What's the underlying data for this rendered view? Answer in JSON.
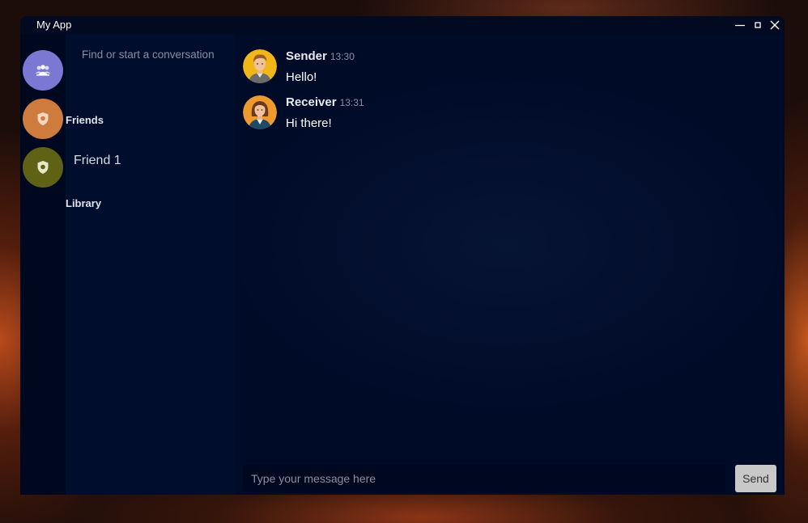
{
  "window": {
    "title": "My App"
  },
  "servers": [
    {
      "name": "group-server",
      "icon": "people-icon",
      "color": "#7b78d4"
    },
    {
      "name": "server-orange",
      "icon": "shield-icon",
      "color": "#cf7b3e"
    },
    {
      "name": "server-olive",
      "icon": "shield-icon",
      "color": "#5f6214"
    }
  ],
  "sidebar": {
    "search_placeholder": "Find or start a conversation",
    "friends_header": "Friends",
    "friends": [
      "Friend 1"
    ],
    "library_header": "Library"
  },
  "messages": [
    {
      "sender": "Sender",
      "time": "13:30",
      "text": "Hello!",
      "avatar": "male-avatar-icon"
    },
    {
      "sender": "Receiver",
      "time": "13:31",
      "text": "Hi there!",
      "avatar": "female-avatar-icon"
    }
  ],
  "composer": {
    "placeholder": "Type your message here",
    "send_label": "Send"
  }
}
